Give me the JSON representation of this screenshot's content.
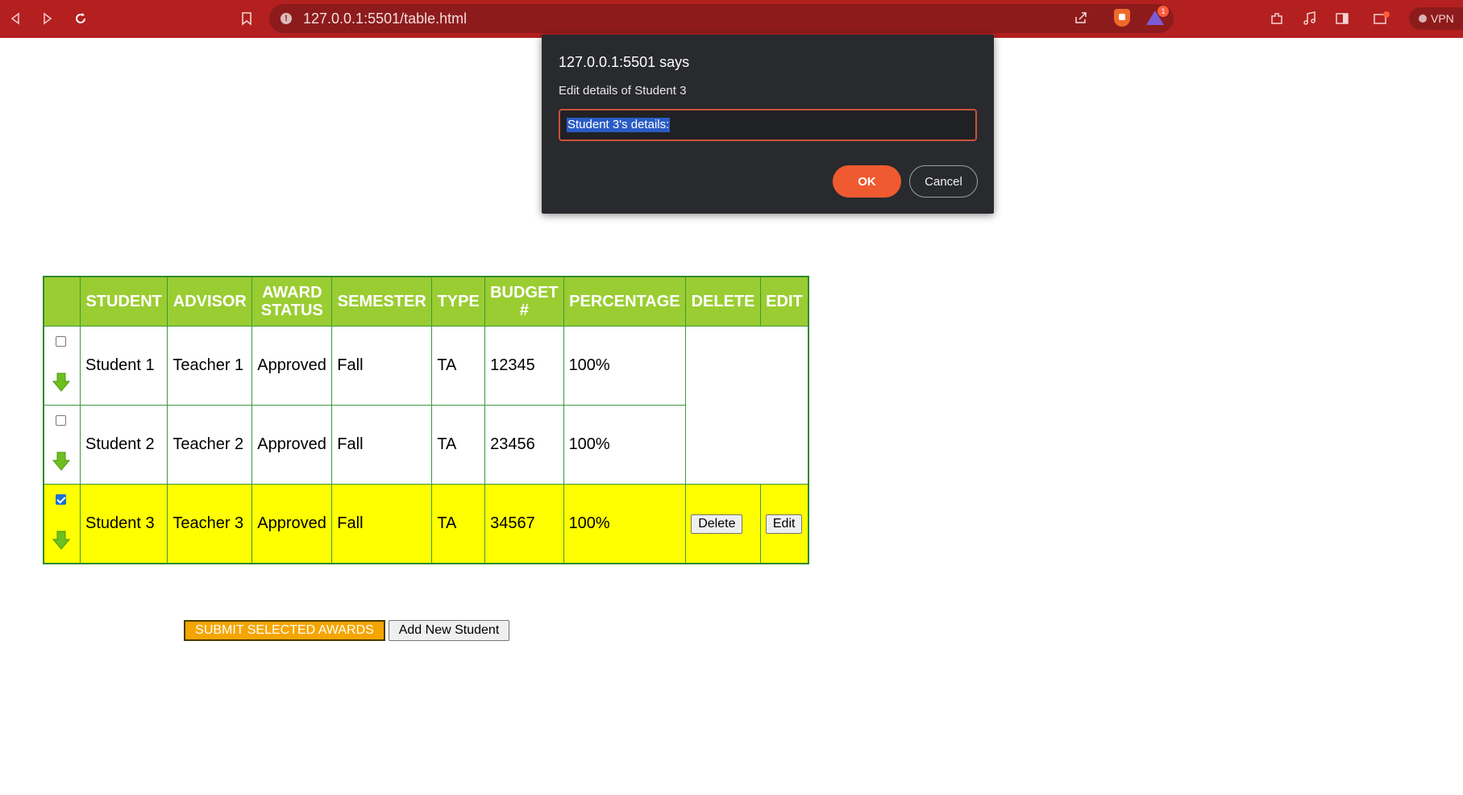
{
  "browser": {
    "url": "127.0.0.1:5501/table.html",
    "vpn_label": "VPN",
    "rewards_badge": "1",
    "theme_color": "#b3201f"
  },
  "dialog": {
    "title": "127.0.0.1:5501 says",
    "message": "Edit details of Student 3",
    "input_value": "Student 3's details:",
    "ok_label": "OK",
    "cancel_label": "Cancel"
  },
  "table": {
    "headers": {
      "student": "STUDENT",
      "advisor": "ADVISOR",
      "award_status": "AWARD STATUS",
      "semester": "SEMESTER",
      "type": "TYPE",
      "budget": "BUDGET #",
      "percentage": "PERCENTAGE",
      "delete": "DELETE",
      "edit": "EDIT"
    },
    "rows": [
      {
        "student": "Student 1",
        "advisor": "Teacher 1",
        "status": "Approved",
        "semester": "Fall",
        "type": "TA",
        "budget": "12345",
        "percentage": "100%",
        "checked": false
      },
      {
        "student": "Student 2",
        "advisor": "Teacher 2",
        "status": "Approved",
        "semester": "Fall",
        "type": "TA",
        "budget": "23456",
        "percentage": "100%",
        "checked": false
      },
      {
        "student": "Student 3",
        "advisor": "Teacher 3",
        "status": "Approved",
        "semester": "Fall",
        "type": "TA",
        "budget": "34567",
        "percentage": "100%",
        "checked": true,
        "delete_label": "Delete",
        "edit_label": "Edit"
      }
    ],
    "header_color": "#9acd32",
    "selected_row_color": "#ffff00"
  },
  "actions": {
    "submit_label": "SUBMIT SELECTED AWARDS",
    "add_label": "Add New Student"
  }
}
